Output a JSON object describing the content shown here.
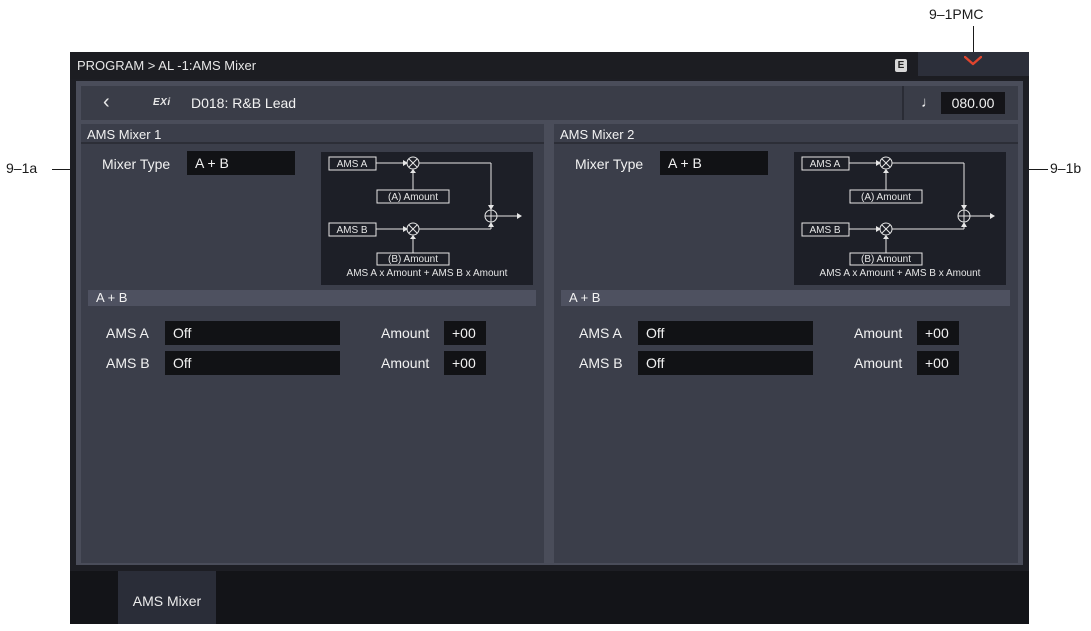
{
  "callouts": {
    "top": "9–1PMC",
    "left": "9–1a",
    "right": "9–1b"
  },
  "titlebar": {
    "title": "PROGRAM > AL -1:AMS Mixer",
    "badge": "E"
  },
  "program": {
    "bank_badge": "EXi",
    "name": "D018: R&B Lead",
    "note_symbol": "♩",
    "tempo": "080.00"
  },
  "mixers": [
    {
      "title": "AMS Mixer 1",
      "mixer_type_label": "Mixer Type",
      "mixer_type_value": "A + B",
      "diagram": {
        "ams_a": "AMS A",
        "ams_b": "AMS B",
        "amount_a": "(A) Amount",
        "amount_b": "(B) Amount",
        "caption": "AMS A x Amount + AMS B x Amount"
      },
      "section_title": "A + B",
      "rows": [
        {
          "label": "AMS A",
          "value": "Off",
          "amount_label": "Amount",
          "amount_value": "+00"
        },
        {
          "label": "AMS B",
          "value": "Off",
          "amount_label": "Amount",
          "amount_value": "+00"
        }
      ]
    },
    {
      "title": "AMS Mixer 2",
      "mixer_type_label": "Mixer Type",
      "mixer_type_value": "A + B",
      "diagram": {
        "ams_a": "AMS A",
        "ams_b": "AMS B",
        "amount_a": "(A) Amount",
        "amount_b": "(B) Amount",
        "caption": "AMS A x Amount + AMS B x Amount"
      },
      "section_title": "A + B",
      "rows": [
        {
          "label": "AMS A",
          "value": "Off",
          "amount_label": "Amount",
          "amount_value": "+00"
        },
        {
          "label": "AMS B",
          "value": "Off",
          "amount_label": "Amount",
          "amount_value": "+00"
        }
      ]
    }
  ],
  "tabs": [
    {
      "label": "AMS Mixer"
    }
  ]
}
